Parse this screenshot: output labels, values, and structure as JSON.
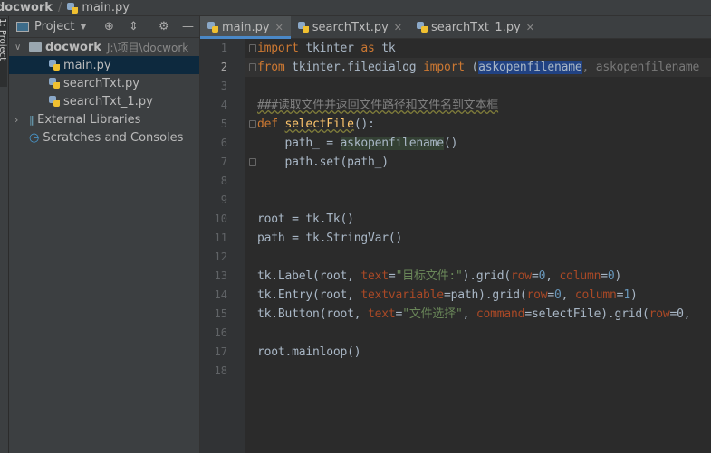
{
  "breadcrumb": {
    "project": "docwork",
    "file": "main.py"
  },
  "sidebar_stripe": {
    "label": "1: Project"
  },
  "project_panel": {
    "title": "Project",
    "root": {
      "name": "docwork",
      "path": "J:\\项目\\docwork"
    },
    "files": [
      "main.py",
      "searchTxt.py",
      "searchTxt_1.py"
    ],
    "external": "External Libraries",
    "scratches": "Scratches and Consoles"
  },
  "tabs": [
    {
      "label": "main.py",
      "active": true
    },
    {
      "label": "searchTxt.py"
    },
    {
      "label": "searchTxt_1.py"
    }
  ],
  "editor": {
    "current_line": 2,
    "lines": [
      [
        [
          "import",
          "kw"
        ],
        [
          " tkinter ",
          ""
        ],
        [
          "as",
          "kw"
        ],
        [
          " tk",
          ""
        ]
      ],
      [
        [
          "from",
          "kw"
        ],
        [
          " tkinter.filedialog ",
          ""
        ],
        [
          "import",
          "kw"
        ],
        [
          " (",
          ""
        ],
        [
          "askopenfilename",
          "sel"
        ],
        [
          ", askopenfilename",
          "dim"
        ]
      ],
      [],
      [
        [
          "###读取文件并返回文件路径和文件名到文本框",
          "cm"
        ]
      ],
      [
        [
          "def",
          "kw"
        ],
        [
          " ",
          ""
        ],
        [
          "selectFile",
          "fn"
        ],
        [
          "():",
          ""
        ]
      ],
      [
        [
          "    path_ = ",
          ""
        ],
        [
          "askopenfilename",
          "hl"
        ],
        [
          "()",
          ""
        ]
      ],
      [
        [
          "    path.set(path_)",
          ""
        ]
      ],
      [],
      [],
      [
        [
          "root = tk.Tk()",
          ""
        ]
      ],
      [
        [
          "path = tk.StringVar()",
          ""
        ]
      ],
      [],
      [
        [
          "tk.Label(root, ",
          ""
        ],
        [
          "text",
          "nm"
        ],
        [
          "=",
          ""
        ],
        [
          "\"目标文件:\"",
          "str"
        ],
        [
          ").grid(",
          ""
        ],
        [
          "row",
          "nm"
        ],
        [
          "=",
          ""
        ],
        [
          "0",
          "num"
        ],
        [
          ", ",
          ""
        ],
        [
          "column",
          "nm"
        ],
        [
          "=",
          ""
        ],
        [
          "0",
          "num"
        ],
        [
          ")",
          ""
        ]
      ],
      [
        [
          "tk.Entry(root, ",
          ""
        ],
        [
          "textvariable",
          "nm"
        ],
        [
          "=path).grid(",
          ""
        ],
        [
          "row",
          "nm"
        ],
        [
          "=",
          ""
        ],
        [
          "0",
          "num"
        ],
        [
          ", ",
          ""
        ],
        [
          "column",
          "nm"
        ],
        [
          "=",
          ""
        ],
        [
          "1",
          "num"
        ],
        [
          ")",
          ""
        ]
      ],
      [
        [
          "tk.Button(root, ",
          ""
        ],
        [
          "text",
          "nm"
        ],
        [
          "=",
          ""
        ],
        [
          "\"文件选择\"",
          "str"
        ],
        [
          ", ",
          ""
        ],
        [
          "command",
          "nm"
        ],
        [
          "=selectFile).grid(",
          ""
        ],
        [
          "row",
          "nm"
        ],
        [
          "=0,",
          ""
        ]
      ],
      [],
      [
        [
          "root.mainloop()",
          ""
        ]
      ],
      []
    ]
  }
}
